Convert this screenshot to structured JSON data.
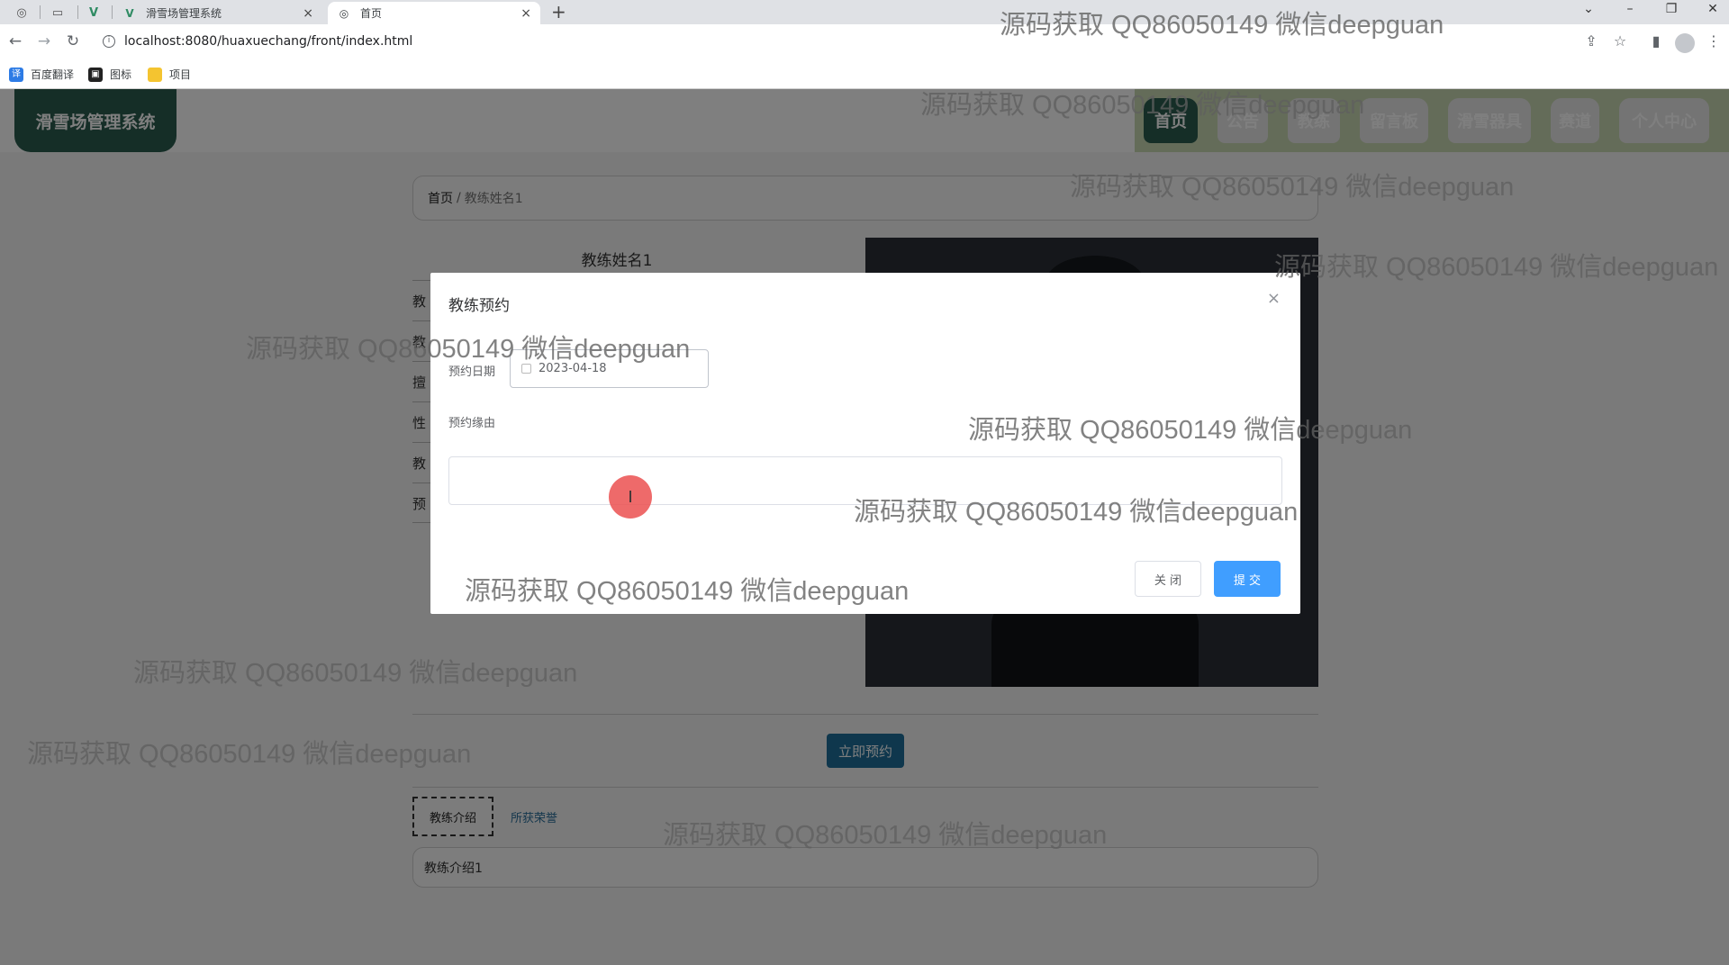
{
  "browser": {
    "tabs": [
      {
        "title": "滑雪场管理系统",
        "icon": "vue-icon"
      },
      {
        "title": "首页",
        "icon": "globe-icon"
      }
    ],
    "url": "localhost:8080/huaxuechang/front/index.html",
    "bookmarks": [
      "百度翻译",
      "图标",
      "项目"
    ]
  },
  "header": {
    "logo": "滑雪场管理系统",
    "menu": [
      "首页",
      "公告",
      "教练",
      "留言板",
      "滑雪器具",
      "赛道",
      "个人中心"
    ],
    "active_menu": "首页"
  },
  "breadcrumb": {
    "home": "首页",
    "separator": "/",
    "current": "教练姓名1"
  },
  "coach": {
    "name": "教练姓名1",
    "row_labels": [
      "教",
      "教",
      "擅",
      "性",
      "教",
      "预"
    ],
    "book_button": "立即预约",
    "tabs": [
      "教练介绍",
      "所获荣誉"
    ],
    "intro": "教练介绍1"
  },
  "dialog": {
    "title": "教练预约",
    "close": "×",
    "date_label": "预约日期",
    "date_value": "2023-04-18",
    "reason_label": "预约缘由",
    "cancel": "关 闭",
    "submit": "提 交"
  },
  "watermark": "源码获取 QQ86050149 微信deepguan",
  "colors": {
    "brand": "#2a5c4f",
    "menu_strip": "#c8d8b3",
    "primary_button": "#409eff",
    "book_button": "#1e6f9a"
  }
}
